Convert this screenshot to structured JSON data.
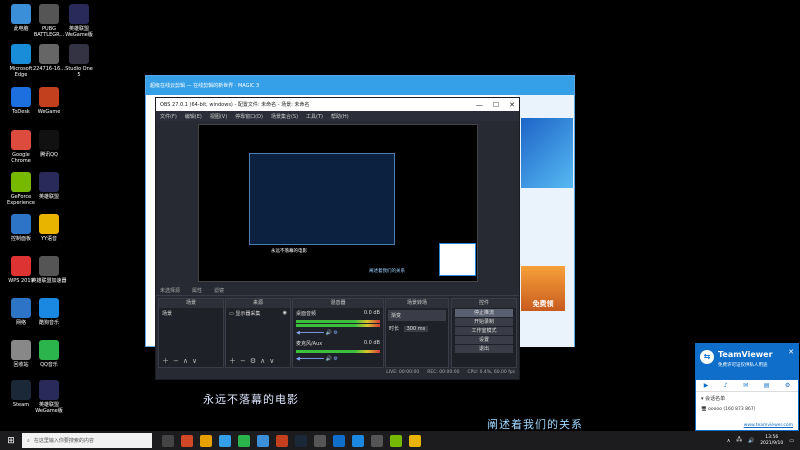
{
  "desktop": {
    "icons": [
      {
        "label": "此电脑",
        "color": "#3b8ed8"
      },
      {
        "label": "PUBG\nBATTLEGR...",
        "color": "#555"
      },
      {
        "label": "英雄联盟\nWeGame版",
        "color": "#2a2a5a"
      },
      {
        "label": "Microsoft\nEdge",
        "color": "#1a8dd8"
      },
      {
        "label": "224716-16...",
        "color": "#666"
      },
      {
        "label": "Studio One\n5",
        "color": "#334"
      },
      {
        "label": "ToDesk",
        "color": "#1d6fe0"
      },
      {
        "label": "WeGame",
        "color": "#c2401e"
      },
      {
        "label": "Google\nChrome",
        "color": "#dd4b3e"
      },
      {
        "label": "腾讯QQ",
        "color": "#111"
      },
      {
        "label": "GeForce\nExperience",
        "color": "#76b900"
      },
      {
        "label": "英雄联盟",
        "color": "#2a2a5a"
      },
      {
        "label": "控制面板",
        "color": "#2d74c7"
      },
      {
        "label": "YY语音",
        "color": "#e8b400"
      },
      {
        "label": "WPS 2019",
        "color": "#d33"
      },
      {
        "label": "英雄联盟加速器",
        "color": "#555"
      },
      {
        "label": "网络",
        "color": "#2d74c7"
      },
      {
        "label": "酷狗音乐",
        "color": "#1a88e0"
      },
      {
        "label": "回收站",
        "color": "#888"
      },
      {
        "label": "QQ音乐",
        "color": "#2cb44c"
      },
      {
        "label": "Steam",
        "color": "#1b2838"
      },
      {
        "label": "英雄联盟\nWeGame版",
        "color": "#2a2a5a"
      }
    ]
  },
  "browser": {
    "title": "超级在线云剪辑 — 在线剪辑的新世界 · MAGIC 3",
    "promo_label": "免费领"
  },
  "obs": {
    "title": "OBS 27.0.1 (64-bit, windows) - 配置文件: 未命名 - 场景: 未命名",
    "menu": [
      "文件(F)",
      "编辑(E)",
      "视图(V)",
      "停靠窗口(D)",
      "场景集合(S)",
      "工具(T)",
      "帮助(H)"
    ],
    "preview_caption": "永远不落幕的电影",
    "preview_caption2": "阐述着我们的关系",
    "source_bar": [
      "未选择源",
      "属性",
      "滤镜"
    ],
    "docks": {
      "scenes": {
        "header": "场景",
        "items": [
          "场景"
        ]
      },
      "sources": {
        "header": "来源",
        "items": [
          "显示器采集"
        ]
      },
      "mixer": {
        "header": "混音器",
        "channels": [
          {
            "name": "桌面音频",
            "db": "0.0 dB"
          },
          {
            "name": "麦克风/Aux",
            "db": "0.0 dB"
          }
        ]
      },
      "transitions": {
        "header": "场景转场",
        "type": "渐变",
        "duration_label": "时长",
        "duration": "300 ms"
      },
      "controls": {
        "header": "控件",
        "buttons": [
          "停止推流",
          "开始录制",
          "工作室模式",
          "设置",
          "退出"
        ]
      }
    },
    "status": [
      "LIVE: 00:00:00",
      "REC: 00:00:00",
      "CPU: 0.4%, 60.00 fps"
    ]
  },
  "subtitles": {
    "line1": "永远不落幕的电影",
    "line2": "阐述着我们的关系"
  },
  "teamviewer": {
    "name": "TeamViewer",
    "desc": "免费许可证仅供私人用途",
    "session_header": "会话名单",
    "contact": "ooooo (160 873 867)",
    "site": "www.teamviewer.com"
  },
  "taskbar": {
    "search_placeholder": "在这里输入你要搜索的内容",
    "apps": [
      "#444",
      "#d24726",
      "#e6a100",
      "#35a0e8",
      "#2cb44c",
      "#3b8ed8",
      "#c2401e",
      "#1b2838",
      "#555",
      "#0e6ec9",
      "#1a88e0",
      "#555",
      "#76b900",
      "#e8b400"
    ],
    "time": "13:56",
    "date": "2021/9/10"
  }
}
